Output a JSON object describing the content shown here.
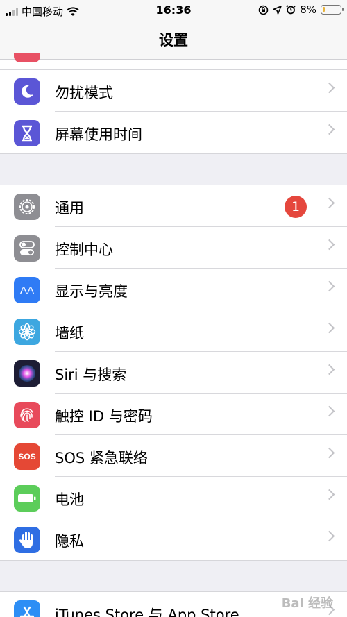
{
  "status_bar": {
    "carrier": "中国移动",
    "time": "16:36",
    "battery_percent": "8%"
  },
  "nav": {
    "title": "设置"
  },
  "group1": [
    {
      "label": "勿扰模式",
      "icon": "moon-icon",
      "color": "#5b56d6"
    },
    {
      "label": "屏幕使用时间",
      "icon": "hourglass-icon",
      "color": "#5b56d6"
    }
  ],
  "group2": [
    {
      "label": "通用",
      "icon": "gear-icon",
      "color": "#8e8e93",
      "badge": "1"
    },
    {
      "label": "控制中心",
      "icon": "toggles-icon",
      "color": "#8e8e93"
    },
    {
      "label": "显示与亮度",
      "icon": "text-size-icon",
      "color": "#2f7bf5",
      "glyph": "AA"
    },
    {
      "label": "墙纸",
      "icon": "flower-icon",
      "color": "#3da7e0"
    },
    {
      "label": "Siri 与搜索",
      "icon": "siri-icon",
      "color": "#1d1d35"
    },
    {
      "label": "触控 ID 与密码",
      "icon": "fingerprint-icon",
      "color": "#e84a5b"
    },
    {
      "label": "SOS 紧急联络",
      "icon": "sos-icon",
      "color": "#e54835",
      "glyph": "SOS"
    },
    {
      "label": "电池",
      "icon": "battery-icon",
      "color": "#5ccd5a"
    },
    {
      "label": "隐私",
      "icon": "hand-icon",
      "color": "#2f6ee3"
    }
  ],
  "group3": [
    {
      "label": "iTunes Store 与 App Store",
      "icon": "app-store-icon",
      "color": "#2d8ef5"
    }
  ],
  "watermark": "Bai 经验"
}
